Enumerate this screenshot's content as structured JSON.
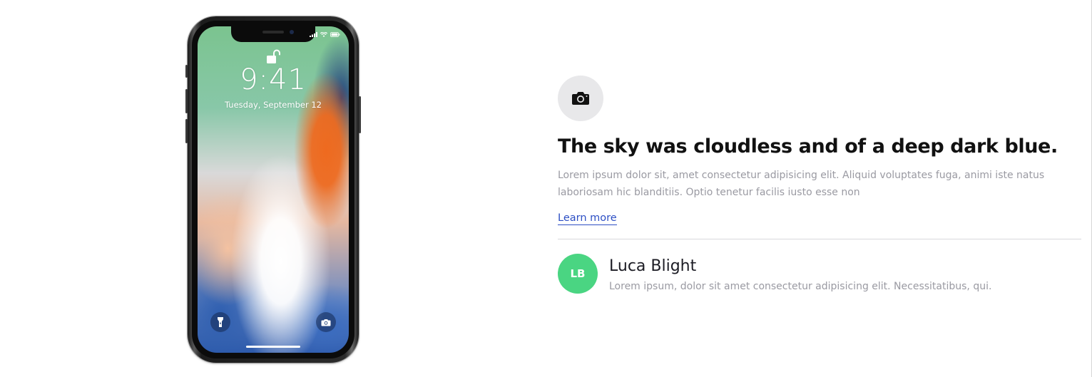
{
  "phone": {
    "time": "9:41",
    "date": "Tuesday, September 12"
  },
  "feature": {
    "icon": "camera-icon",
    "headline": "The sky was cloudless and of a deep dark blue.",
    "body": "Lorem ipsum dolor sit, amet consectetur adipisicing elit. Aliquid voluptates fuga, animi iste natus laboriosam hic blanditiis. Optio tenetur facilis iusto esse non",
    "link_label": "Learn more"
  },
  "author": {
    "initials": "LB",
    "name": "Luca Blight",
    "description": "Lorem ipsum, dolor sit amet consectetur adipisicing elit. Necessitatibus, qui."
  },
  "colors": {
    "link": "#2d4fc4",
    "avatar_bg": "#4ad582",
    "icon_bg": "#e8e8ea",
    "muted_text": "#9a9aa2"
  }
}
